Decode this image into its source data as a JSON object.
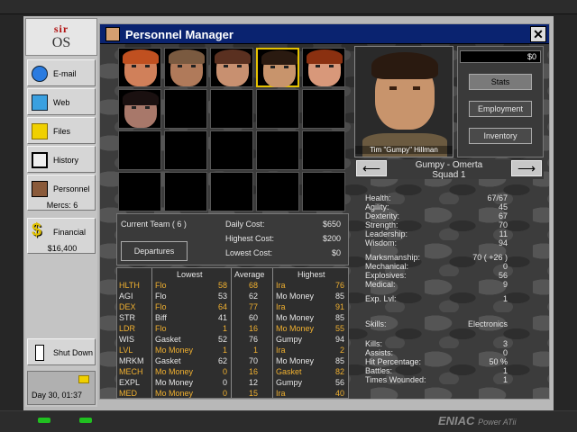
{
  "os": {
    "logo_top": "sir",
    "logo_bottom": "OS"
  },
  "sidebar": {
    "items": [
      {
        "label": "E-mail",
        "icon": "email-icon"
      },
      {
        "label": "Web",
        "icon": "web-icon"
      },
      {
        "label": "Files",
        "icon": "folder-icon"
      },
      {
        "label": "History",
        "icon": "book-icon"
      },
      {
        "label": "Personnel",
        "icon": "personnel-icon",
        "sub": "Mercs: 6"
      },
      {
        "label": "Financial",
        "icon": "dollar-icon",
        "sub": "$16,400"
      },
      {
        "label": "Shut Down",
        "icon": "power-icon"
      }
    ],
    "datetime": "Day 30, 01:37"
  },
  "window": {
    "title": "Personnel Manager",
    "close": "✕"
  },
  "team": {
    "current_team": "Current Team ( 6 )",
    "daily_cost_label": "Daily Cost:",
    "daily_cost": "$650",
    "highest_cost_label": "Highest Cost:",
    "highest_cost": "$200",
    "lowest_cost_label": "Lowest Cost:",
    "lowest_cost": "$0",
    "departures": "Departures"
  },
  "stats": {
    "headers": {
      "lowest": "Lowest",
      "average": "Average",
      "highest": "Highest"
    },
    "rows": [
      {
        "stat": "HLTH",
        "low_name": "Flo",
        "low": "58",
        "avg": "68",
        "high_name": "Ira",
        "high": "76",
        "hl": true
      },
      {
        "stat": "AGI",
        "low_name": "Flo",
        "low": "53",
        "avg": "62",
        "high_name": "Mo Money",
        "high": "85",
        "hl": false
      },
      {
        "stat": "DEX",
        "low_name": "Flo",
        "low": "64",
        "avg": "77",
        "high_name": "Ira",
        "high": "91",
        "hl": true
      },
      {
        "stat": "STR",
        "low_name": "Biff",
        "low": "41",
        "avg": "60",
        "high_name": "Mo Money",
        "high": "85",
        "hl": false
      },
      {
        "stat": "LDR",
        "low_name": "Flo",
        "low": "1",
        "avg": "16",
        "high_name": "Mo Money",
        "high": "55",
        "hl": true
      },
      {
        "stat": "WIS",
        "low_name": "Gasket",
        "low": "52",
        "avg": "76",
        "high_name": "Gumpy",
        "high": "94",
        "hl": false
      },
      {
        "stat": "LVL",
        "low_name": "Mo Money",
        "low": "1",
        "avg": "1",
        "high_name": "Ira",
        "high": "2",
        "hl": true
      },
      {
        "stat": "MRKM",
        "low_name": "Gasket",
        "low": "62",
        "avg": "70",
        "high_name": "Mo Money",
        "high": "85",
        "hl": false
      },
      {
        "stat": "MECH",
        "low_name": "Mo Money",
        "low": "0",
        "avg": "16",
        "high_name": "Gasket",
        "high": "82",
        "hl": true
      },
      {
        "stat": "EXPL",
        "low_name": "Mo Money",
        "low": "0",
        "avg": "12",
        "high_name": "Gumpy",
        "high": "56",
        "hl": false
      },
      {
        "stat": "MED",
        "low_name": "Mo Money",
        "low": "0",
        "avg": "15",
        "high_name": "Ira",
        "high": "40",
        "hl": true
      }
    ]
  },
  "selected": {
    "portrait_name": "Tim \"Gumpy\" Hillman",
    "money": "$0",
    "buttons": {
      "stats": "Stats",
      "employment": "Employment",
      "inventory": "Inventory"
    },
    "nav_line1": "Gumpy - Omerta",
    "nav_line2": "Squad 1",
    "prev": "⟵",
    "next": "⟶",
    "attributes": [
      {
        "k": "Health:",
        "v": "67/67"
      },
      {
        "k": "Agility:",
        "v": "45"
      },
      {
        "k": "Dexterity:",
        "v": "67"
      },
      {
        "k": "Strength:",
        "v": "70"
      },
      {
        "k": "Leadership:",
        "v": "11"
      },
      {
        "k": "Wisdom:",
        "v": "94"
      }
    ],
    "skills_attr": [
      {
        "k": "Marksmanship:",
        "v": "70  ( +26 )"
      },
      {
        "k": "Mechanical:",
        "v": "0"
      },
      {
        "k": "Explosives:",
        "v": "56"
      },
      {
        "k": "Medical:",
        "v": "9"
      }
    ],
    "exp_label": "Exp. Lvl:",
    "exp": "1",
    "skills_label": "Skills:",
    "skills": "Electronics",
    "record": [
      {
        "k": "Kills:",
        "v": "3"
      },
      {
        "k": "Assists:",
        "v": "0"
      },
      {
        "k": "Hit Percentage:",
        "v": "50 %"
      },
      {
        "k": "Battles:",
        "v": "1"
      },
      {
        "k": "Times Wounded:",
        "v": "1"
      }
    ]
  },
  "brand": {
    "name": "ENIAC",
    "model": "Power ATii"
  },
  "colors": {
    "title_bar": "#0a2370",
    "highlight": "#f0b030",
    "select_border": "#e6c200"
  }
}
